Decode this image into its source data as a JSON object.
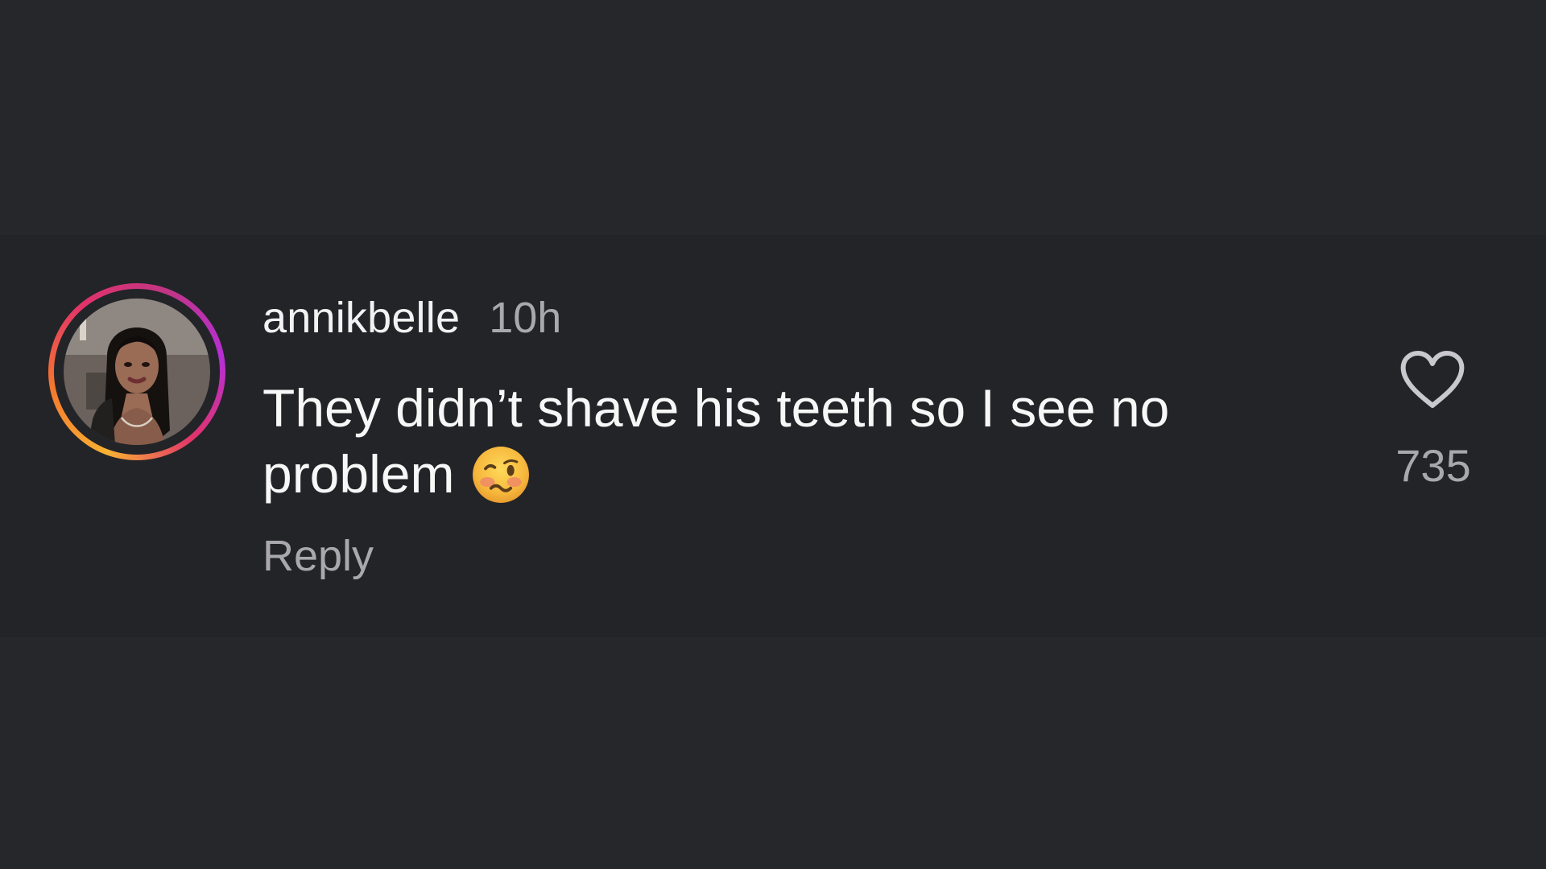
{
  "comment": {
    "username": "annikbelle",
    "timestamp": "10h",
    "text": "They didn’t shave his teeth so I see no problem",
    "emoji_icon": "woozy-face-emoji",
    "reply_label": "Reply",
    "like_icon": "heart-outline-icon",
    "like_count": "735"
  },
  "colors": {
    "background": "#26272b",
    "comment_band": "#232428",
    "primary_text": "#f7f7f7",
    "secondary_text": "#a8a8ae",
    "story_ring": [
      "#f9b233",
      "#e2336b",
      "#b52fd6"
    ]
  }
}
